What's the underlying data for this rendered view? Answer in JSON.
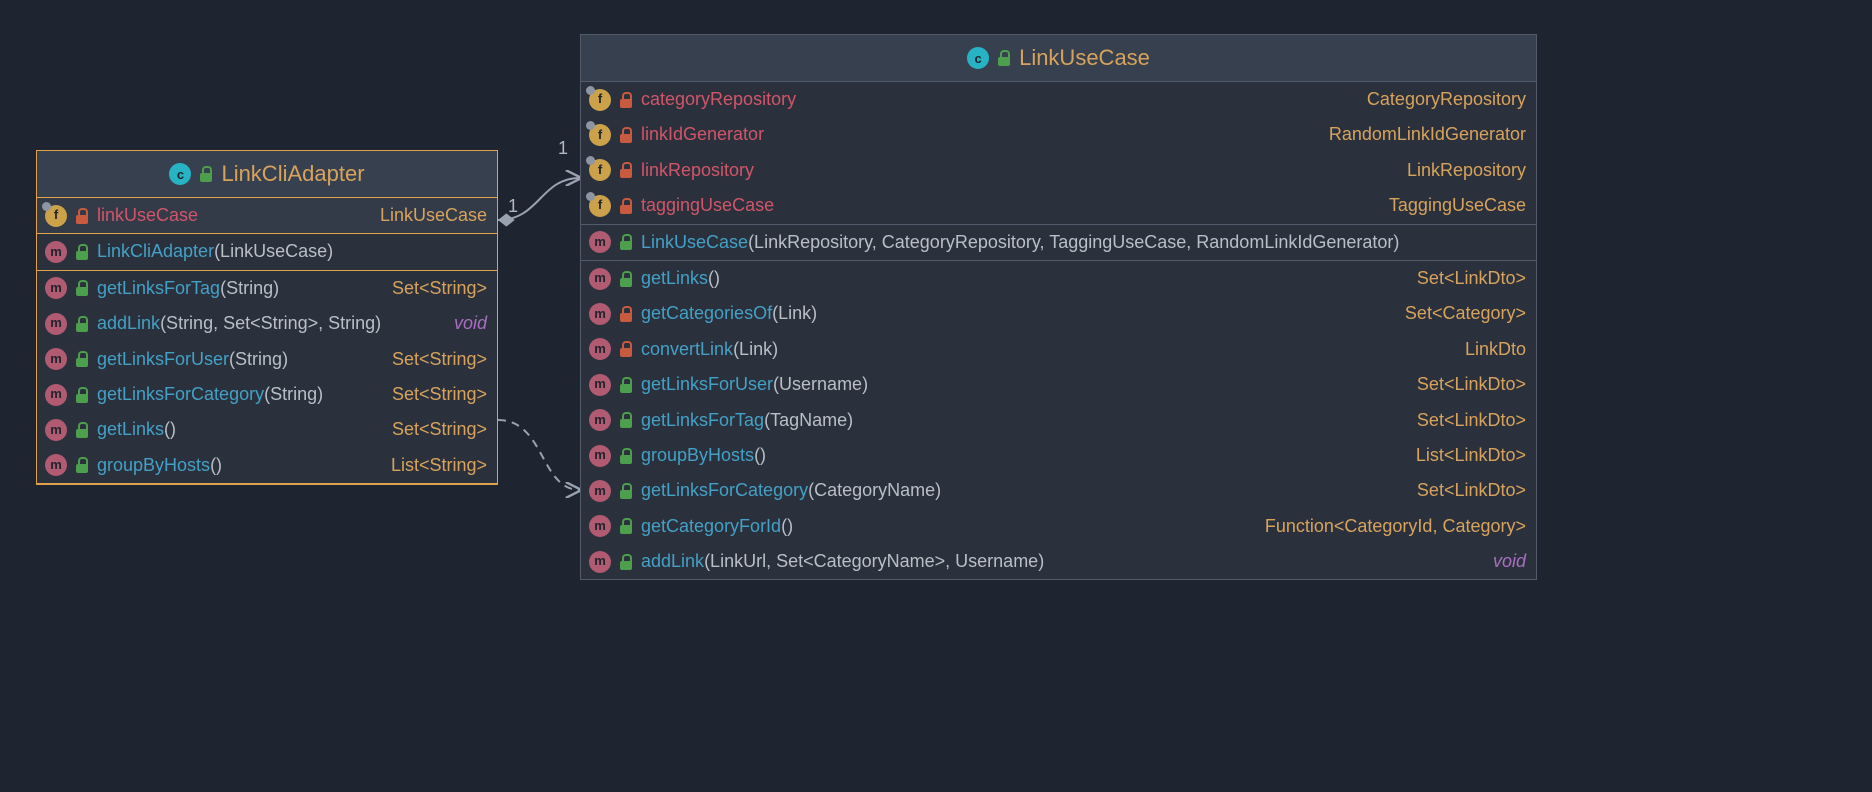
{
  "relation_labels": {
    "end_a": "1",
    "end_b": "1"
  },
  "classes": {
    "adapter": {
      "title": "LinkCliAdapter",
      "fields": [
        {
          "name": "linkUseCase",
          "type": "LinkUseCase",
          "visibility": "private",
          "highlighted": true
        }
      ],
      "constructors": [
        {
          "name": "LinkCliAdapter",
          "params": "(LinkUseCase)",
          "visibility": "public"
        }
      ],
      "methods": [
        {
          "name": "getLinksForTag",
          "params": "(String)",
          "ret": "Set<String>",
          "visibility": "public"
        },
        {
          "name": "addLink",
          "params": "(String, Set<String>, String)",
          "ret": "void",
          "visibility": "public"
        },
        {
          "name": "getLinksForUser",
          "params": "(String)",
          "ret": "Set<String>",
          "visibility": "public"
        },
        {
          "name": "getLinksForCategory",
          "params": "(String)",
          "ret": "Set<String>",
          "visibility": "public"
        },
        {
          "name": "getLinks",
          "params": "()",
          "ret": "Set<String>",
          "visibility": "public"
        },
        {
          "name": "groupByHosts",
          "params": "()",
          "ret": "List<String>",
          "visibility": "public"
        }
      ]
    },
    "usecase": {
      "title": "LinkUseCase",
      "fields": [
        {
          "name": "categoryRepository",
          "type": "CategoryRepository",
          "visibility": "private"
        },
        {
          "name": "linkIdGenerator",
          "type": "RandomLinkIdGenerator",
          "visibility": "private"
        },
        {
          "name": "linkRepository",
          "type": "LinkRepository",
          "visibility": "private"
        },
        {
          "name": "taggingUseCase",
          "type": "TaggingUseCase",
          "visibility": "private"
        }
      ],
      "constructors": [
        {
          "name": "LinkUseCase",
          "params": "(LinkRepository, CategoryRepository, TaggingUseCase, RandomLinkIdGenerator)",
          "visibility": "public"
        }
      ],
      "methods": [
        {
          "name": "getLinks",
          "params": "()",
          "ret": "Set<LinkDto>",
          "visibility": "public"
        },
        {
          "name": "getCategoriesOf",
          "params": "(Link)",
          "ret": "Set<Category>",
          "visibility": "private"
        },
        {
          "name": "convertLink",
          "params": "(Link)",
          "ret": "LinkDto",
          "visibility": "private"
        },
        {
          "name": "getLinksForUser",
          "params": "(Username)",
          "ret": "Set<LinkDto>",
          "visibility": "public"
        },
        {
          "name": "getLinksForTag",
          "params": "(TagName)",
          "ret": "Set<LinkDto>",
          "visibility": "public"
        },
        {
          "name": "groupByHosts",
          "params": "()",
          "ret": "List<LinkDto>",
          "visibility": "public"
        },
        {
          "name": "getLinksForCategory",
          "params": "(CategoryName)",
          "ret": "Set<LinkDto>",
          "visibility": "public"
        },
        {
          "name": "getCategoryForId",
          "params": "()",
          "ret": "Function<CategoryId, Category>",
          "visibility": "public"
        },
        {
          "name": "addLink",
          "params": "(LinkUrl, Set<CategoryName>, Username)",
          "ret": "void",
          "visibility": "public"
        }
      ]
    }
  }
}
